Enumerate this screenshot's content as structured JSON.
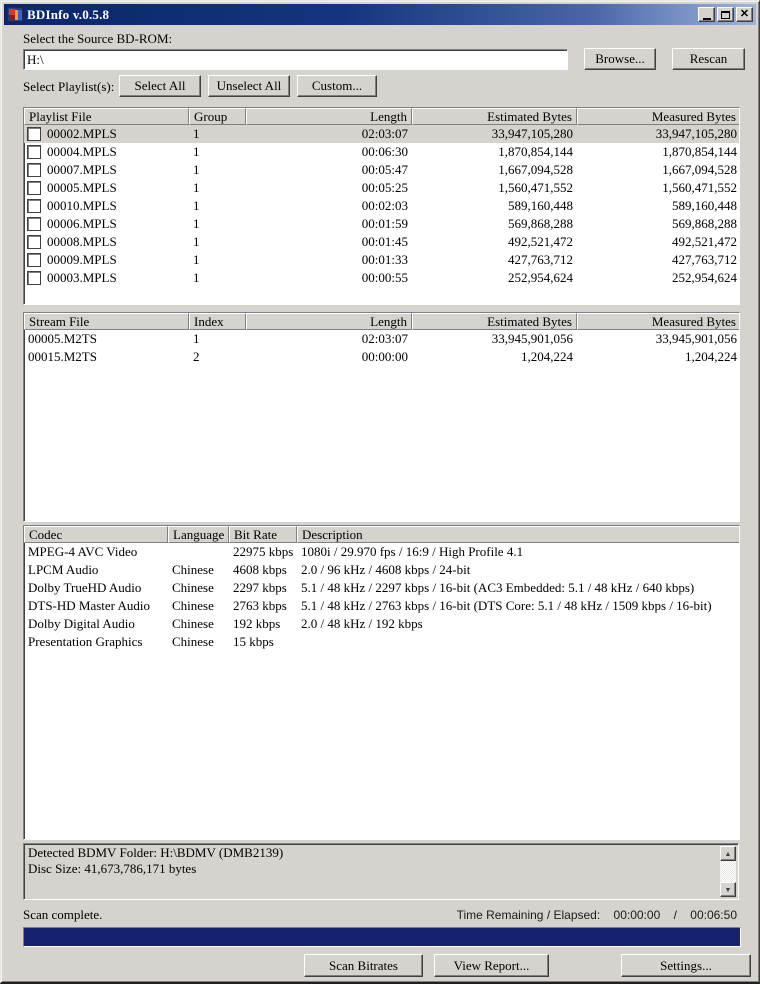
{
  "window": {
    "title": "BDInfo v.0.5.8",
    "colors": {
      "titlebar_start": "#0b2668",
      "titlebar_end": "#9db4de",
      "progress_fill": "#16226f",
      "chrome": "#d6d3ce"
    }
  },
  "source": {
    "label": "Select the Source BD-ROM:",
    "path": "H:\\",
    "browse_label": "Browse...",
    "rescan_label": "Rescan"
  },
  "playlist_controls": {
    "label": "Select Playlist(s):",
    "select_all_label": "Select All",
    "unselect_all_label": "Unselect All",
    "custom_label": "Custom..."
  },
  "playlist_table": {
    "headers": [
      "Playlist File",
      "Group",
      "Length",
      "Estimated Bytes",
      "Measured Bytes"
    ],
    "rows": [
      {
        "_class": "selected",
        "file": "00002.MPLS",
        "group": "1",
        "length": "02:03:07",
        "estimated": "33,947,105,280",
        "measured": "33,947,105,280"
      },
      {
        "file": "00004.MPLS",
        "group": "1",
        "length": "00:06:30",
        "estimated": "1,870,854,144",
        "measured": "1,870,854,144"
      },
      {
        "file": "00007.MPLS",
        "group": "1",
        "length": "00:05:47",
        "estimated": "1,667,094,528",
        "measured": "1,667,094,528"
      },
      {
        "file": "00005.MPLS",
        "group": "1",
        "length": "00:05:25",
        "estimated": "1,560,471,552",
        "measured": "1,560,471,552"
      },
      {
        "file": "00010.MPLS",
        "group": "1",
        "length": "00:02:03",
        "estimated": "589,160,448",
        "measured": "589,160,448"
      },
      {
        "file": "00006.MPLS",
        "group": "1",
        "length": "00:01:59",
        "estimated": "569,868,288",
        "measured": "569,868,288"
      },
      {
        "file": "00008.MPLS",
        "group": "1",
        "length": "00:01:45",
        "estimated": "492,521,472",
        "measured": "492,521,472"
      },
      {
        "file": "00009.MPLS",
        "group": "1",
        "length": "00:01:33",
        "estimated": "427,763,712",
        "measured": "427,763,712"
      },
      {
        "file": "00003.MPLS",
        "group": "1",
        "length": "00:00:55",
        "estimated": "252,954,624",
        "measured": "252,954,624"
      }
    ]
  },
  "stream_table": {
    "headers": [
      "Stream File",
      "Index",
      "Length",
      "Estimated Bytes",
      "Measured Bytes"
    ],
    "rows": [
      {
        "file": "00005.M2TS",
        "index": "1",
        "length": "02:03:07",
        "estimated": "33,945,901,056",
        "measured": "33,945,901,056"
      },
      {
        "file": "00015.M2TS",
        "index": "2",
        "length": "00:00:00",
        "estimated": "1,204,224",
        "measured": "1,204,224"
      }
    ]
  },
  "codec_table": {
    "headers": [
      "Codec",
      "Language",
      "Bit Rate",
      "Description"
    ],
    "rows": [
      {
        "codec": "MPEG-4 AVC Video",
        "language": "",
        "bitrate": "22975 kbps",
        "description": "1080i / 29.970 fps / 16:9 / High Profile 4.1"
      },
      {
        "codec": "LPCM Audio",
        "language": "Chinese",
        "bitrate": "4608 kbps",
        "description": "2.0 / 96 kHz / 4608 kbps / 24-bit"
      },
      {
        "codec": "Dolby TrueHD Audio",
        "language": "Chinese",
        "bitrate": "2297 kbps",
        "description": "5.1 / 48 kHz / 2297 kbps / 16-bit (AC3 Embedded: 5.1 / 48 kHz / 640 kbps)"
      },
      {
        "codec": "DTS-HD Master Audio",
        "language": "Chinese",
        "bitrate": "2763 kbps",
        "description": "5.1 / 48 kHz / 2763 kbps / 16-bit (DTS Core: 5.1 / 48 kHz / 1509 kbps / 16-bit)"
      },
      {
        "codec": "Dolby Digital Audio",
        "language": "Chinese",
        "bitrate": "192 kbps",
        "description": "2.0 / 48 kHz / 192 kbps"
      },
      {
        "codec": "Presentation Graphics",
        "language": "Chinese",
        "bitrate": "15 kbps",
        "description": ""
      }
    ]
  },
  "info_box": {
    "line1": "Detected BDMV Folder: H:\\BDMV (DMB2139)",
    "line2": "Disc Size: 41,673,786,171 bytes"
  },
  "status": {
    "text": "Scan complete.",
    "time_label": "Time Remaining / Elapsed:",
    "remaining": "00:00:00",
    "separator": "/",
    "elapsed": "00:06:50",
    "progress_percent": 100
  },
  "actions": {
    "scan_bitrates_label": "Scan Bitrates",
    "view_report_label": "View Report...",
    "settings_label": "Settings..."
  },
  "icons": {
    "close": "✕",
    "scroll_up": "▲",
    "scroll_down": "▼"
  }
}
